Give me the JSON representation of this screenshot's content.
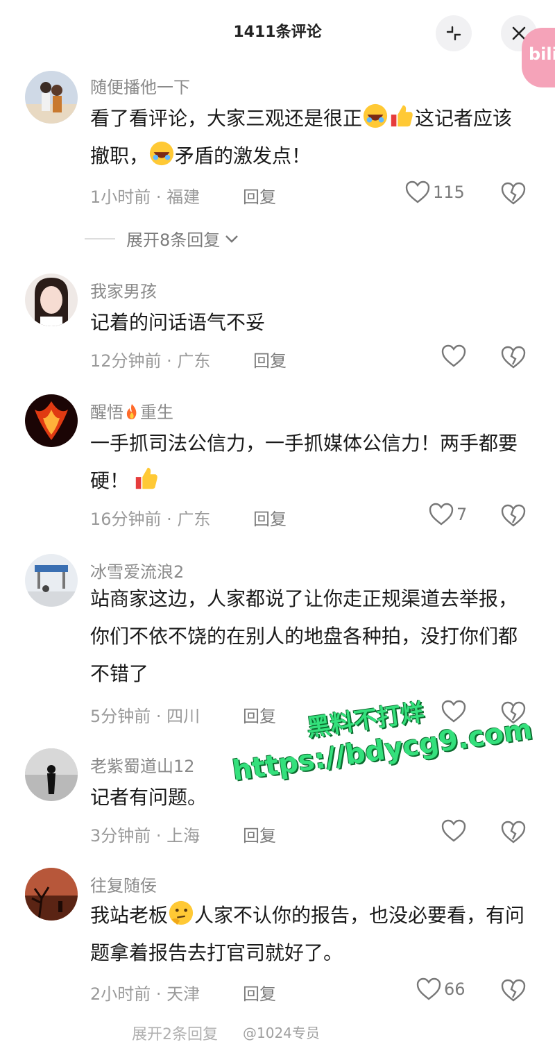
{
  "header": {
    "title": "1411条评论",
    "collapse_icon": "collapse-icon",
    "close_icon": "close-icon",
    "badge": "bili"
  },
  "comments": [
    {
      "username": "随便播他一下",
      "text_parts": [
        "看了看评论，大家三观还是很正",
        "这记者应该撤职，",
        "矛盾的激发点！"
      ],
      "time": "1小时前 · 福建",
      "reply": "回复",
      "likes": "115",
      "expand": "展开8条回复"
    },
    {
      "username": "我家男孩",
      "text": "记着的问话语气不妥",
      "time": "12分钟前 · 广东",
      "reply": "回复",
      "likes": ""
    },
    {
      "username_parts": [
        "醒悟",
        "重生"
      ],
      "text": "一手抓司法公信力，一手抓媒体公信力！两手都要硬！",
      "time": "16分钟前 · 广东",
      "reply": "回复",
      "likes": "7"
    },
    {
      "username": "冰雪爱流浪2",
      "text": "站商家这边，人家都说了让你走正规渠道去举报，你们不依不饶的在别人的地盘各种拍，没打你们都不错了",
      "time": "5分钟前 · 四川",
      "reply": "回复",
      "likes": ""
    },
    {
      "username": "老紫蜀道山12",
      "text": "记者有问题。",
      "time": "3分钟前 · 上海",
      "reply": "回复",
      "likes": ""
    },
    {
      "username": "往复随佞",
      "text_parts": [
        "我站老板",
        "人家不认你的报告，也没必要看，有问题拿着报告去打官司就好了。"
      ],
      "time": "2小时前 · 天津",
      "reply": "回复",
      "likes": "66"
    }
  ],
  "watermark": {
    "line1": "黑料不打烊",
    "line2": "https://bdycg9.com"
  },
  "footer": {
    "partial_expand": "展开2条回复",
    "source": "@1024专员"
  },
  "colors": {
    "meta": "#9a9a9a",
    "watermark": "#34e07c",
    "badge": "#f5a3b9"
  }
}
